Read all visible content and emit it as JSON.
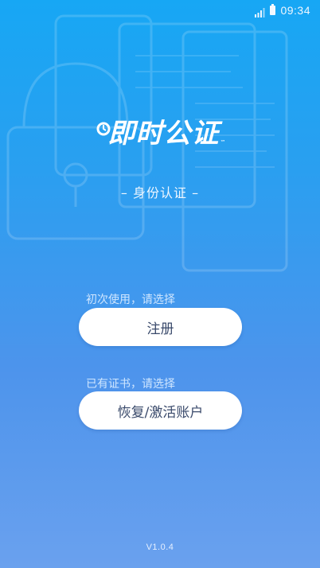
{
  "status_bar": {
    "time": "09:34",
    "icons": [
      "signal-icon",
      "battery-icon"
    ]
  },
  "app": {
    "logo_text": "即时公证",
    "logo_tm": "™",
    "subtitle": "– 身份认证 –"
  },
  "register": {
    "hint": "初次使用，请选择",
    "button_label": "注册"
  },
  "recover": {
    "hint": "已有证书，请选择",
    "button_label": "恢复/激活账户"
  },
  "footer": {
    "version": "V1.0.4"
  },
  "colors": {
    "gradient_top": "#17a7f4",
    "gradient_bottom": "#6aa1ee",
    "button_bg": "#ffffff",
    "button_text": "#3a4a6b",
    "hint_text": "#cfe6ff"
  }
}
